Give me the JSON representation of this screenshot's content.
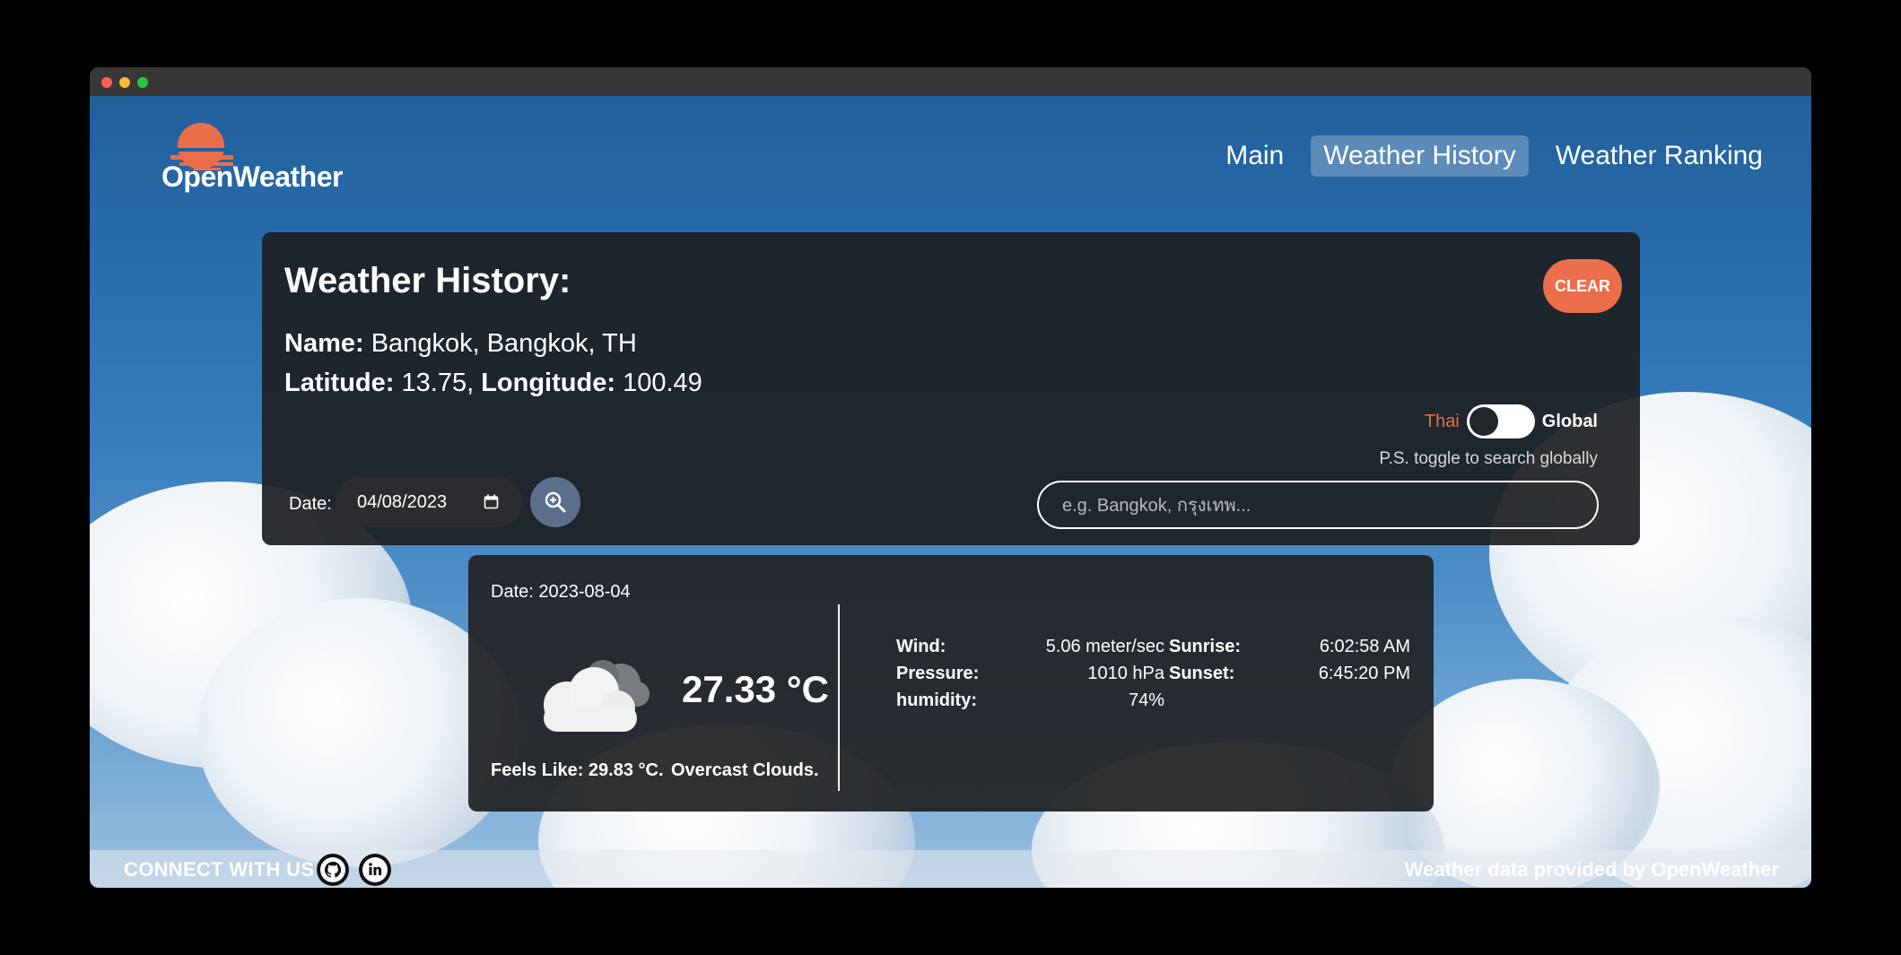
{
  "brand": {
    "name": "OpenWeather",
    "accent": "#eb6e4b"
  },
  "nav": {
    "items": [
      {
        "label": "Main",
        "active": false
      },
      {
        "label": "Weather History",
        "active": true
      },
      {
        "label": "Weather Ranking",
        "active": false
      }
    ]
  },
  "history": {
    "title": "Weather History:",
    "clear_label": "CLEAR",
    "name_label": "Name:",
    "name_value": "Bangkok, Bangkok, TH",
    "lat_label": "Latitude:",
    "lat_value": "13.75,",
    "lon_label": "Longitude:",
    "lon_value": "100.49",
    "toggle": {
      "left_label": "Thai",
      "right_label": "Global",
      "hint": "P.S. toggle to search globally",
      "on": false
    },
    "date_label": "Date:",
    "date_value": "04/08/2023",
    "search_placeholder": "e.g. Bangkok, กรุงเทพ..."
  },
  "result": {
    "date": "Date: 2023-08-04",
    "temperature": "27.33 °C",
    "feels_like": "Feels Like: 29.83 °C.",
    "description": "Overcast Clouds.",
    "icon": "cloud-icon",
    "stats_left": [
      {
        "label": "Wind:",
        "value": "5.06 meter/sec"
      },
      {
        "label": "Pressure:",
        "value": "1010 hPa"
      },
      {
        "label": "humidity:",
        "value": "74%"
      }
    ],
    "stats_right": [
      {
        "label": "Sunrise:",
        "value": "6:02:58 AM"
      },
      {
        "label": "Sunset:",
        "value": "6:45:20 PM"
      }
    ]
  },
  "footer": {
    "connect": "CONNECT WITH US",
    "credit": "Weather data provided by OpenWeather",
    "social": [
      "github-icon",
      "linkedin-icon"
    ]
  }
}
